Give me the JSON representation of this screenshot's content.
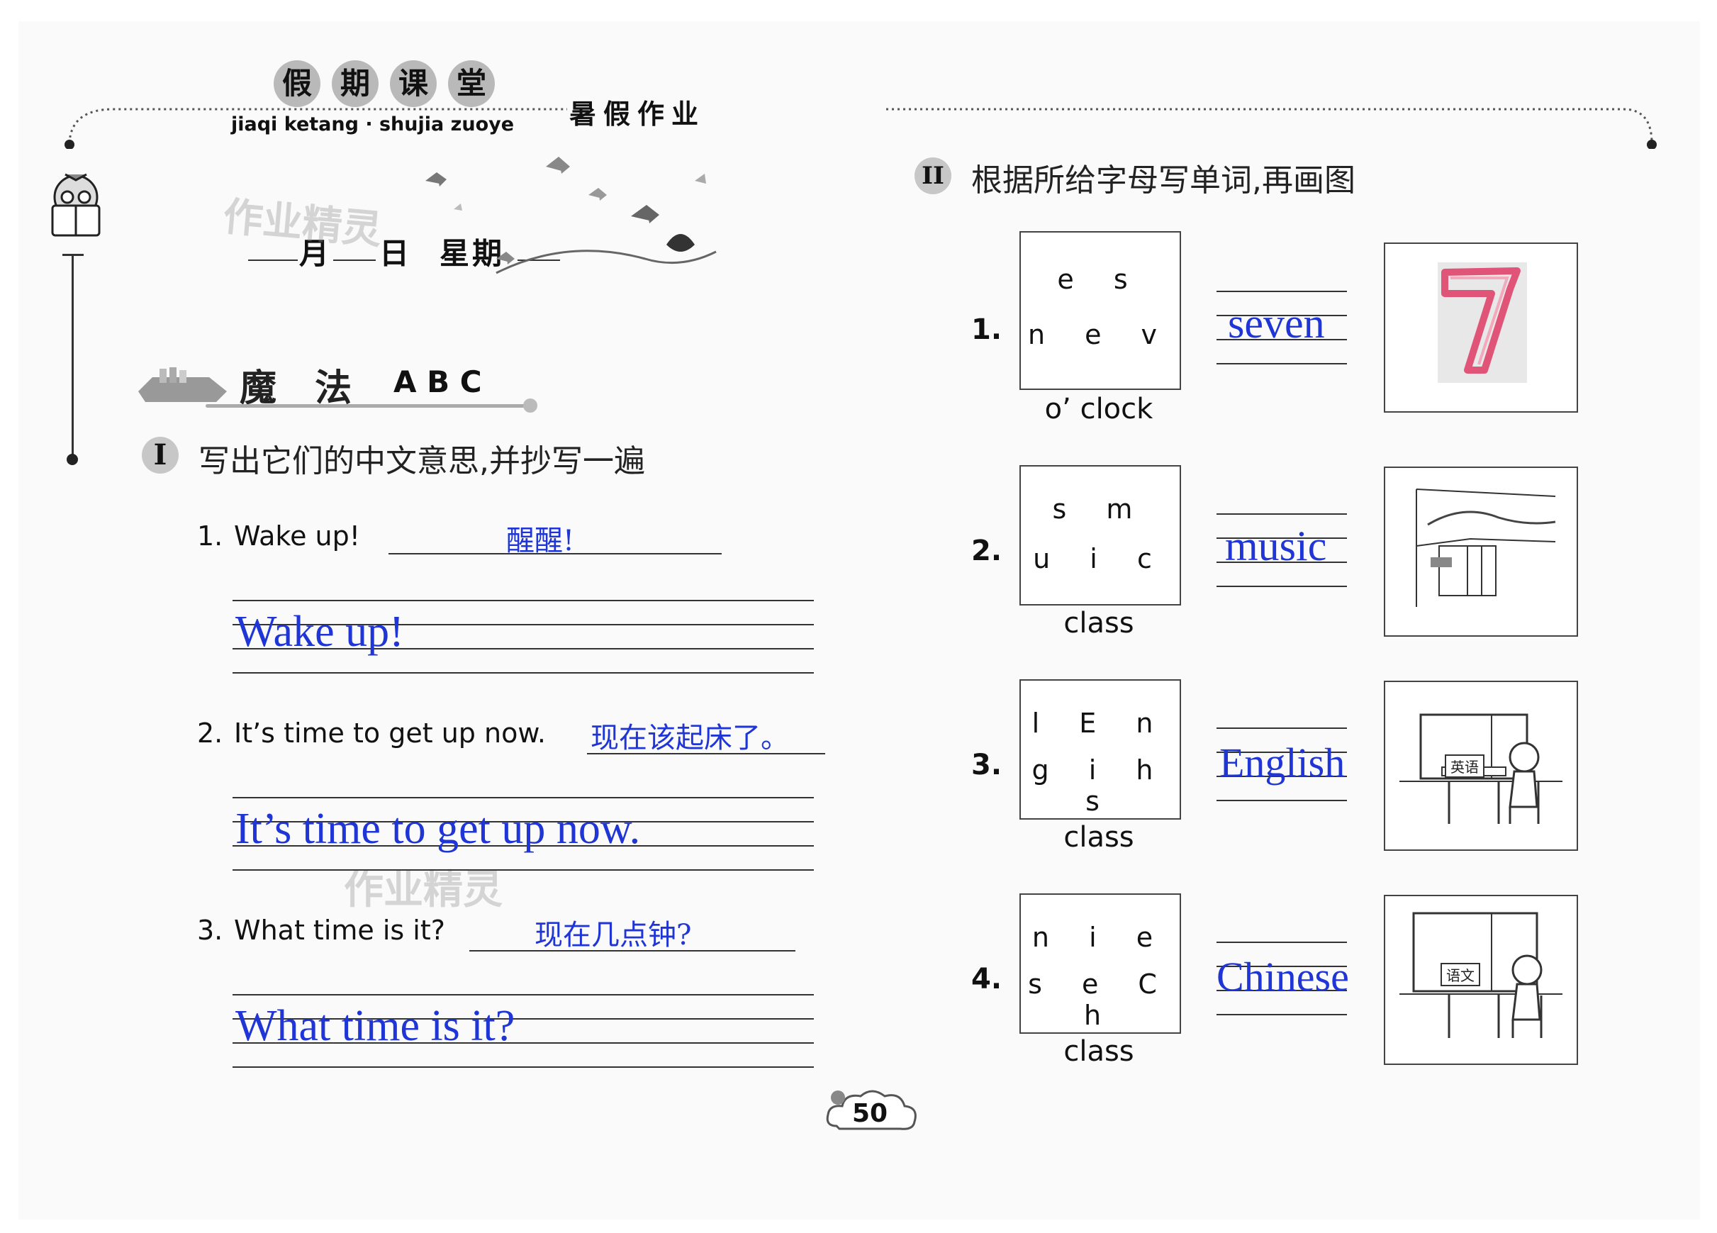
{
  "header": {
    "chars": [
      "假",
      "期",
      "课",
      "堂"
    ],
    "pinyin": "jiaqi ketang · shujia zuoye",
    "title": "暑假作业"
  },
  "date_line": {
    "month": "月",
    "day": "日",
    "week": "星期"
  },
  "watermark": "作业精灵",
  "section_title": {
    "magic": "魔",
    "fa": "法",
    "abc": "A B C"
  },
  "part1": {
    "roman": "I",
    "instruction": "写出它们的中文意思,并抄写一遍",
    "items": [
      {
        "num": "1.",
        "text": "Wake up!",
        "cn": "醒醒!",
        "copy": "Wake up!"
      },
      {
        "num": "2.",
        "text": "It’s time to get up now.",
        "cn": "现在该起床了。",
        "copy": "It’s time to get up now."
      },
      {
        "num": "3.",
        "text": "What time is it?",
        "cn": "现在几点钟?",
        "copy": "What time is it?"
      }
    ]
  },
  "part2": {
    "roman": "II",
    "instruction": "根据所给字母写单词,再画图",
    "items": [
      {
        "num": "1.",
        "letters_top": "e s",
        "letters_bottom": "n e v",
        "caption": "o’ clock",
        "answer": "seven",
        "picture": "number-seven"
      },
      {
        "num": "2.",
        "letters_top": "s m",
        "letters_bottom": "u i c",
        "caption": "class",
        "answer": "music",
        "picture": "music-classroom"
      },
      {
        "num": "3.",
        "letters_top": "l E n",
        "letters_bottom": "g i h s",
        "caption": "class",
        "answer": "English",
        "picture": "english-classroom",
        "sign": "英语"
      },
      {
        "num": "4.",
        "letters_top": "n i e",
        "letters_bottom": "s e C h",
        "caption": "class",
        "answer": "Chinese",
        "picture": "chinese-classroom",
        "sign": "语文"
      }
    ]
  },
  "page_number": "50",
  "colors": {
    "answer_blue": "#1f35d6",
    "seven_pink": "#e05577"
  }
}
